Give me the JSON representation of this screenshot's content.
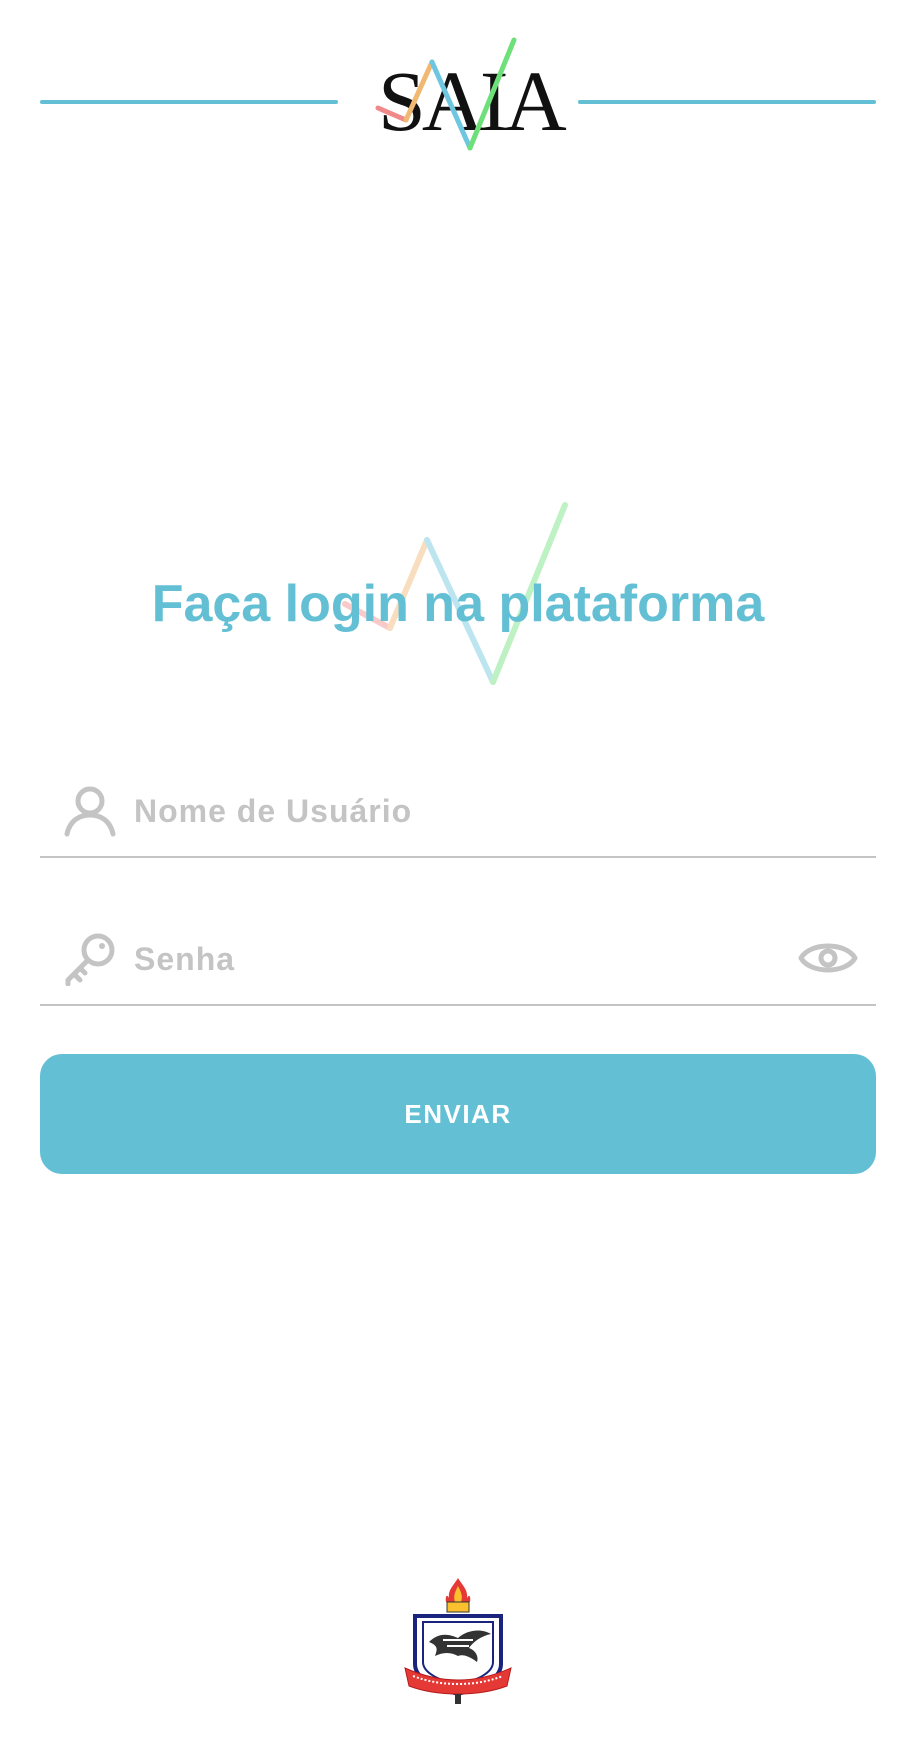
{
  "header": {
    "logo_text": "SAIA"
  },
  "login": {
    "title": "Faça login na plataforma",
    "username_placeholder": "Nome de Usuário",
    "password_placeholder": "Senha",
    "submit_label": "ENVIAR"
  },
  "footer": {
    "seal_text": "UNIVERSIDADE FEDERAL DO PARÁ"
  },
  "colors": {
    "accent": "#63bfd4",
    "line_red": "#f08a8a",
    "line_orange": "#f0b870",
    "line_blue": "#6ec6e0",
    "line_green": "#6ee07a",
    "placeholder": "#c4c4c4"
  },
  "icons": {
    "username": "user-icon",
    "password": "key-icon",
    "toggle_visibility": "eye-icon"
  }
}
